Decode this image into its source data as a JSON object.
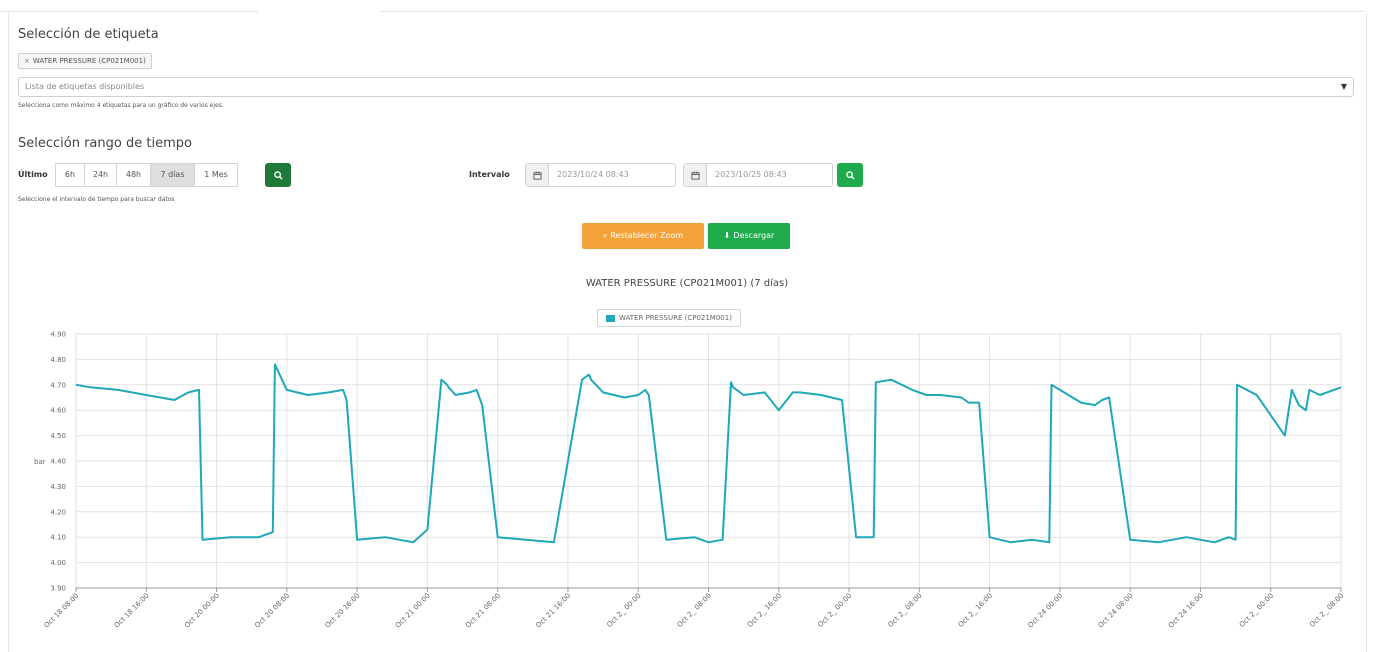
{
  "tag_selection": {
    "title": "Selección de etiqueta",
    "selected_tag": "WATER PRESSURE (CP021M001)",
    "remove_symbol": "×",
    "placeholder": "Lista de etiquetas disponibles",
    "help": "Selecciona como máximo 4 etiquetas para un gráfico de varios ejes."
  },
  "time_range": {
    "title": "Selección rango de tiempo",
    "last_label": "Último",
    "options": [
      "6h",
      "24h",
      "48h",
      "7 días",
      "1 Mes"
    ],
    "active_option": "7 días",
    "interval_label": "Intervalo",
    "start": "2023/10/24 08:43",
    "end": "2023/10/25 08:43",
    "help": "Seleccione el intervalo de tiempo para buscar datos"
  },
  "actions": {
    "reset_zoom": "Restablecer Zoom",
    "download": "Descargar"
  },
  "colors": {
    "series": "#1fa8b8",
    "dark_green": "#1f7a3a",
    "green": "#1faa4c",
    "orange": "#f5a23a"
  },
  "chart_data": {
    "type": "line",
    "title": "WATER PRESSURE (CP021M001) (7 días)",
    "ylabel": "bar",
    "ylim": [
      4.0,
      4.9
    ],
    "y_ticks": [
      "4.90",
      "4.80",
      "4.70",
      "4.60",
      "4.50",
      "4.40",
      "4.30",
      "4.20",
      "4.10",
      "4.00",
      "3.90"
    ],
    "x_ticks": [
      "Oct 18 08:00",
      "Oct 18 16:00",
      "Oct 20 00:00",
      "Oct 20 08:00",
      "Oct 20 16:00",
      "Oct 21 00:00",
      "Oct 21 08:00",
      "Oct 21 16:00",
      "Oct 2_ 00:00",
      "Oct 2_ 08:00",
      "Oct 2_ 16:00",
      "Oct 2_ 00:00",
      "Oct 2_ 08:00",
      "Oct 2_ 16:00",
      "Oct 24 00:00",
      "Oct 24 08:00",
      "Oct 24 16:00",
      "Oct 2_ 00:00",
      "Oct 2_ 08:00"
    ],
    "grid": true,
    "legend_position": "top-center",
    "series": [
      {
        "name": "WATER PRESSURE (CP021M001)",
        "x": [
          0,
          0.2,
          0.6,
          1.0,
          1.4,
          1.6,
          1.75,
          1.8,
          2.2,
          2.6,
          2.8,
          2.83,
          3.0,
          3.3,
          3.6,
          3.8,
          3.85,
          4.0,
          4.4,
          4.8,
          5.0,
          5.2,
          5.28,
          5.3,
          5.4,
          5.6,
          5.7,
          5.78,
          6.0,
          6.4,
          6.8,
          7.2,
          7.3,
          7.33,
          7.5,
          7.8,
          8.0,
          8.1,
          8.15,
          8.4,
          8.8,
          9.0,
          9.2,
          9.32,
          9.35,
          9.5,
          9.8,
          10.0,
          10.2,
          10.3,
          10.6,
          10.9,
          11.1,
          11.35,
          11.38,
          11.6,
          11.9,
          12.1,
          12.2,
          12.3,
          12.6,
          12.7,
          12.85,
          13.0,
          13.3,
          13.6,
          13.85,
          13.88,
          14.0,
          14.3,
          14.5,
          14.6,
          14.7,
          15.0,
          15.4,
          15.8,
          16.2,
          16.4,
          16.5,
          16.52,
          16.8,
          17.2,
          17.3,
          17.4,
          17.5,
          17.55,
          17.7,
          18.0
        ],
        "y": [
          4.7,
          4.69,
          4.68,
          4.66,
          4.64,
          4.67,
          4.68,
          4.09,
          4.1,
          4.1,
          4.12,
          4.78,
          4.68,
          4.66,
          4.67,
          4.68,
          4.64,
          4.09,
          4.1,
          4.08,
          4.13,
          4.72,
          4.7,
          4.69,
          4.66,
          4.67,
          4.68,
          4.62,
          4.1,
          4.09,
          4.08,
          4.72,
          4.74,
          4.72,
          4.67,
          4.65,
          4.66,
          4.68,
          4.66,
          4.09,
          4.1,
          4.08,
          4.09,
          4.71,
          4.69,
          4.66,
          4.67,
          4.6,
          4.67,
          4.67,
          4.66,
          4.64,
          4.1,
          4.1,
          4.71,
          4.72,
          4.68,
          4.66,
          4.66,
          4.66,
          4.65,
          4.63,
          4.63,
          4.1,
          4.08,
          4.09,
          4.08,
          4.7,
          4.68,
          4.63,
          4.62,
          4.64,
          4.65,
          4.09,
          4.08,
          4.1,
          4.08,
          4.1,
          4.09,
          4.7,
          4.66,
          4.5,
          4.68,
          4.62,
          4.6,
          4.68,
          4.66,
          4.69
        ]
      }
    ]
  }
}
